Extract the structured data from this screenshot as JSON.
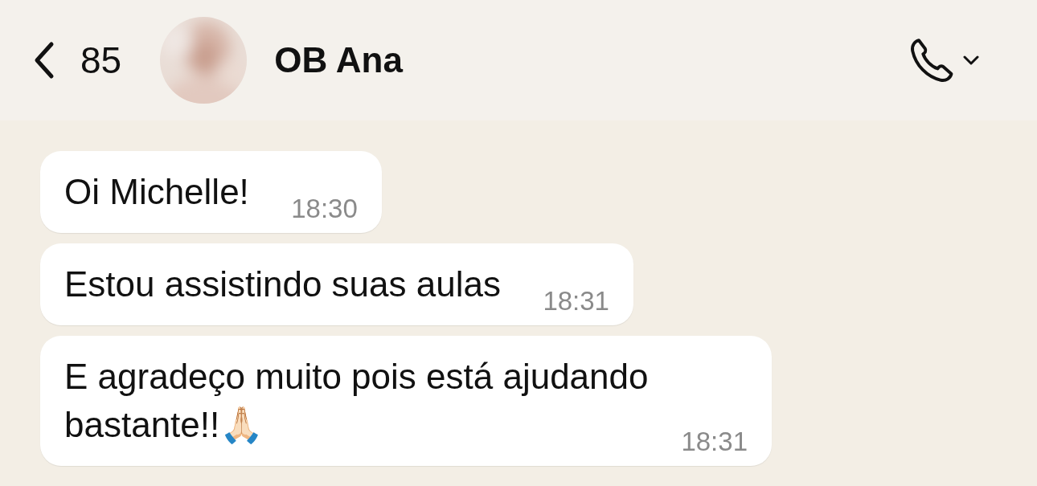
{
  "header": {
    "back_count": "85",
    "contact_name": "OB Ana"
  },
  "messages": [
    {
      "text": "Oi Michelle!",
      "time": "18:30"
    },
    {
      "text": "Estou assistindo suas aulas",
      "time": "18:31"
    },
    {
      "text": "E agradeço muito pois está ajudando bastante!!🙏🏻",
      "time": "18:31"
    }
  ]
}
